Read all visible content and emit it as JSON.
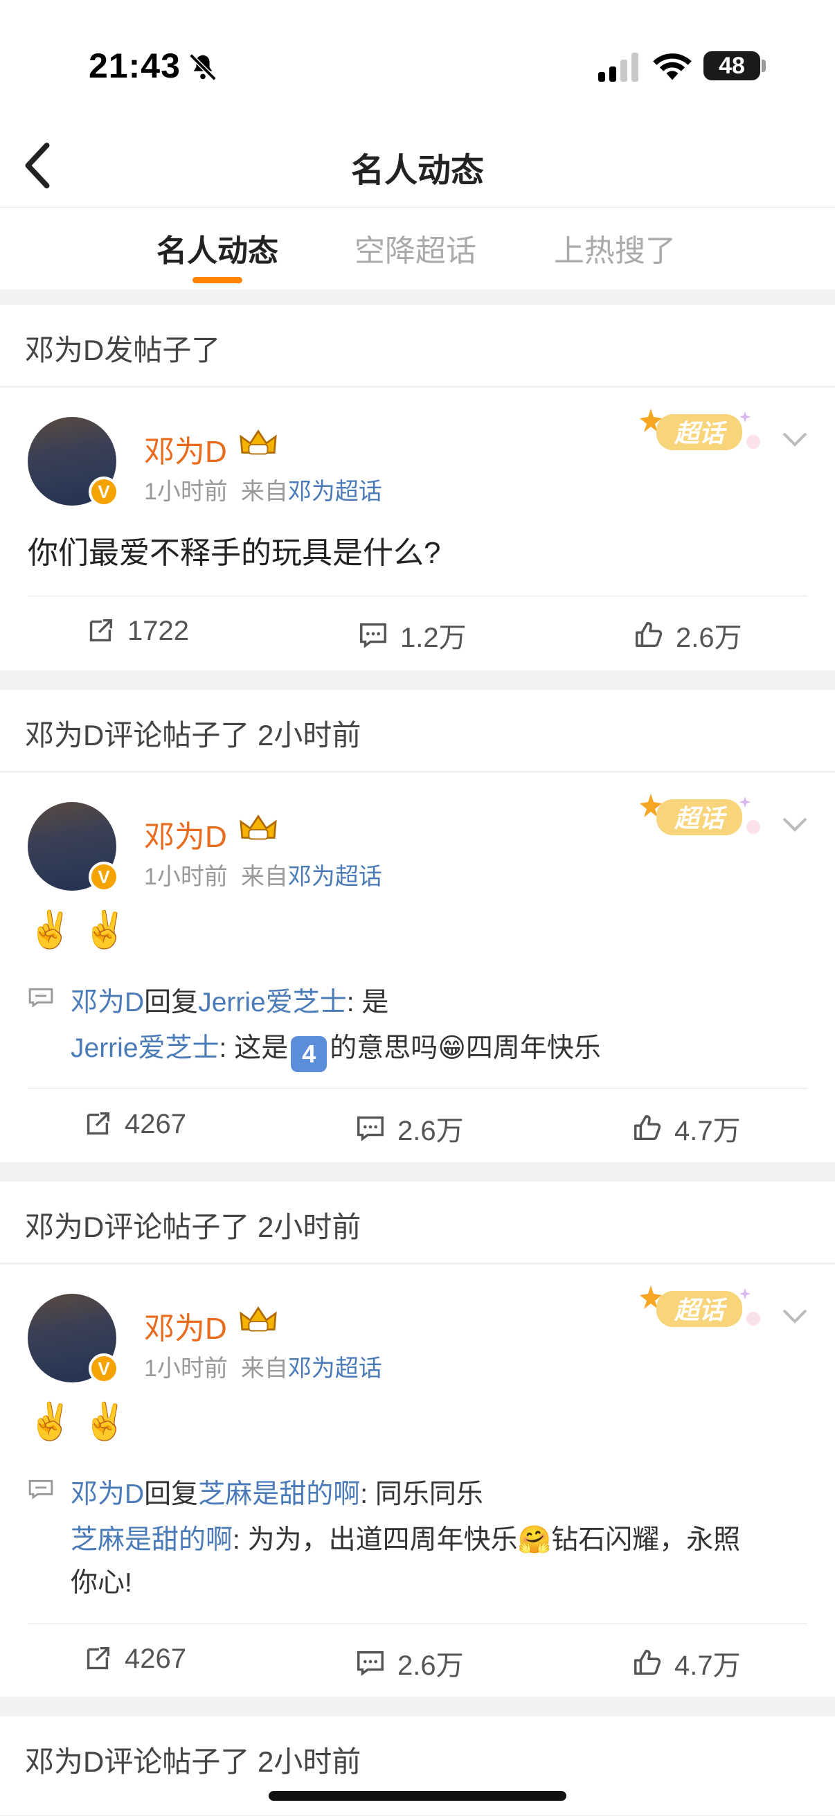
{
  "status_bar": {
    "time": "21:43",
    "battery": "48"
  },
  "nav": {
    "title": "名人动态"
  },
  "tabs": [
    {
      "label": "名人动态",
      "active": true
    },
    {
      "label": "空降超话",
      "active": false
    },
    {
      "label": "上热搜了",
      "active": false
    }
  ],
  "sections": [
    {
      "header": "邓为D发帖子了",
      "post": {
        "user": "邓为D",
        "time": "1小时前",
        "from_prefix": "来自",
        "from": "邓为超话",
        "badge": "超话",
        "text": "你们最爱不释手的玩具是什么?",
        "reposts": "1722",
        "comments": "1.2万",
        "likes": "2.6万"
      }
    },
    {
      "header": "邓为D评论帖子了 2小时前",
      "post": {
        "user": "邓为D",
        "time": "1小时前",
        "from_prefix": "来自",
        "from": "邓为超话",
        "badge": "超话",
        "emoji": "✌️ ✌️",
        "reply_user": "邓为D",
        "reply_word": "回复",
        "reply_target": "Jerrie爱芝士",
        "reply_text": ": 是",
        "quote_user": "Jerrie爱芝士",
        "quote_pre": ": 这是",
        "quote_kb": "4",
        "quote_post": "的意思吗😁四周年快乐",
        "reposts": "4267",
        "comments": "2.6万",
        "likes": "4.7万"
      }
    },
    {
      "header": "邓为D评论帖子了 2小时前",
      "post": {
        "user": "邓为D",
        "time": "1小时前",
        "from_prefix": "来自",
        "from": "邓为超话",
        "badge": "超话",
        "emoji": "✌️ ✌️",
        "reply_user": "邓为D",
        "reply_word": "回复",
        "reply_target": "芝麻是甜的啊",
        "reply_text": ": 同乐同乐",
        "quote_user": "芝麻是甜的啊",
        "quote_text_1": ": 为为，出道四周年快乐🤗钻石闪耀，永照",
        "quote_text_2": "你心!",
        "reposts": "4267",
        "comments": "2.6万",
        "likes": "4.7万"
      }
    },
    {
      "header": "邓为D评论帖子了 2小时前"
    }
  ],
  "colors": {
    "accent": "#ff8200",
    "username": "#e86b1e",
    "link": "#4a7bb8"
  }
}
